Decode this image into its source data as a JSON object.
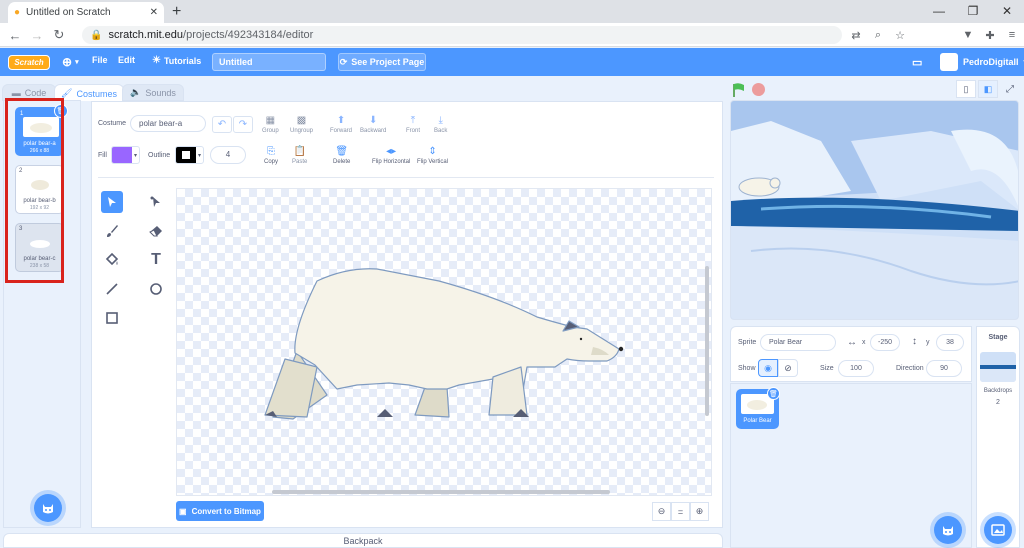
{
  "browser": {
    "tab_title": "Untitled on Scratch",
    "url_host": "scratch.mit.edu",
    "url_path": "/projects/492343184/editor",
    "profile_initial": "M"
  },
  "menu": {
    "logo": "Scratch",
    "file": "File",
    "edit": "Edit",
    "tutorials": "Tutorials",
    "project_title": "Untitled",
    "see_project": "See Project Page",
    "username": "PedroDigitall"
  },
  "tabs": {
    "code": "Code",
    "costumes": "Costumes",
    "sounds": "Sounds"
  },
  "costumes": [
    {
      "num": "1",
      "name": "polar bear-a",
      "size": "266 x 88"
    },
    {
      "num": "2",
      "name": "polar bear-b",
      "size": "192 x 92"
    },
    {
      "num": "3",
      "name": "polar bear-c",
      "size": "238 x 58"
    }
  ],
  "editor": {
    "costume_label": "Costume",
    "costume_name": "polar bear-a",
    "group": "Group",
    "ungroup": "Ungroup",
    "forward": "Forward",
    "backward": "Backward",
    "front": "Front",
    "back": "Back",
    "fill_label": "Fill",
    "outline_label": "Outline",
    "outline_width": "4",
    "copy": "Copy",
    "paste": "Paste",
    "delete": "Delete",
    "flip_h": "Flip Horizontal",
    "flip_v": "Flip Vertical",
    "convert": "Convert to Bitmap",
    "zoom_reset": "="
  },
  "colors": {
    "accent": "#4c97ff",
    "fill": "#9966ff",
    "outline": "#000000",
    "highlight": "#d9231c"
  },
  "backpack": "Backpack",
  "sprite": {
    "sprite_label": "Sprite",
    "name": "Polar Bear",
    "x_label": "x",
    "x": "-250",
    "y_label": "y",
    "y": "38",
    "show_label": "Show",
    "size_label": "Size",
    "size": "100",
    "direction_label": "Direction",
    "direction": "90"
  },
  "stage_panel": {
    "title": "Stage",
    "backdrops_label": "Backdrops",
    "backdrops_count": "2"
  }
}
